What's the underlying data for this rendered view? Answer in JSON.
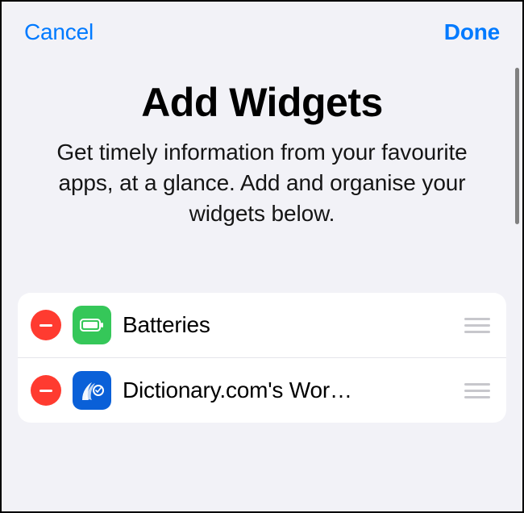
{
  "header": {
    "cancel_label": "Cancel",
    "done_label": "Done"
  },
  "title_section": {
    "title": "Add Widgets",
    "subtitle": "Get timely information from your favourite apps, at a glance. Add and organise your widgets below."
  },
  "widgets": [
    {
      "label": "Batteries",
      "icon": "battery-icon",
      "icon_bg": "#35c759"
    },
    {
      "label": "Dictionary.com's Wor…",
      "icon": "dictionary-icon",
      "icon_bg": "#0a60d8"
    }
  ]
}
